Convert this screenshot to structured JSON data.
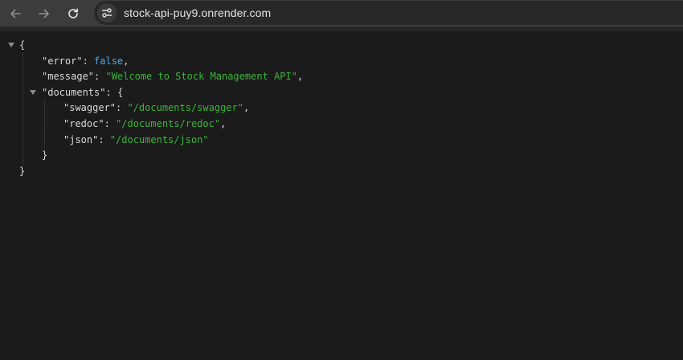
{
  "browser": {
    "url": "stock-api-puy9.onrender.com"
  },
  "json_view": {
    "open_brace": "{",
    "close_brace": "}",
    "error_key": "\"error\"",
    "error_value": "false",
    "message_key": "\"message\"",
    "message_value": "\"Welcome to Stock Management API\"",
    "documents_key": "\"documents\"",
    "documents_open": "{",
    "documents_close": "}",
    "swagger_key": "\"swagger\"",
    "swagger_value": "\"/documents/swagger\"",
    "redoc_key": "\"redoc\"",
    "redoc_value": "\"/documents/redoc\"",
    "json_key": "\"json\"",
    "json_value": "\"/documents/json\"",
    "colon": ": ",
    "comma": ","
  },
  "colors": {
    "string": "#3ab53a",
    "boolean": "#58a9e8",
    "text": "#dadada",
    "background": "#1b1b1b"
  }
}
